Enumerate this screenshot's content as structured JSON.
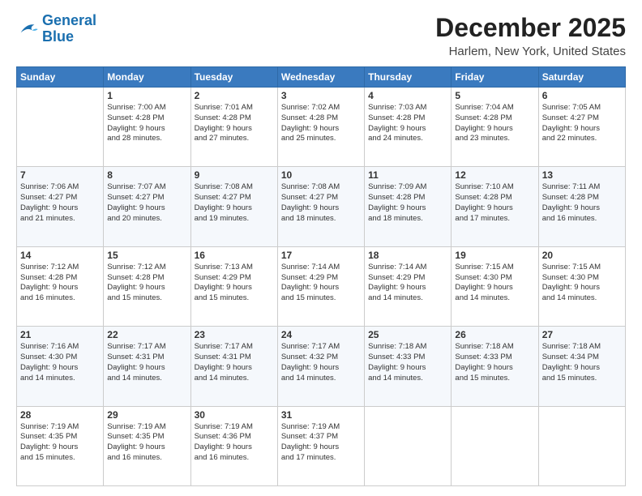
{
  "header": {
    "logo_line1": "General",
    "logo_line2": "Blue",
    "main_title": "December 2025",
    "subtitle": "Harlem, New York, United States"
  },
  "days_of_week": [
    "Sunday",
    "Monday",
    "Tuesday",
    "Wednesday",
    "Thursday",
    "Friday",
    "Saturday"
  ],
  "weeks": [
    [
      {
        "day": "",
        "info": ""
      },
      {
        "day": "1",
        "info": "Sunrise: 7:00 AM\nSunset: 4:28 PM\nDaylight: 9 hours\nand 28 minutes."
      },
      {
        "day": "2",
        "info": "Sunrise: 7:01 AM\nSunset: 4:28 PM\nDaylight: 9 hours\nand 27 minutes."
      },
      {
        "day": "3",
        "info": "Sunrise: 7:02 AM\nSunset: 4:28 PM\nDaylight: 9 hours\nand 25 minutes."
      },
      {
        "day": "4",
        "info": "Sunrise: 7:03 AM\nSunset: 4:28 PM\nDaylight: 9 hours\nand 24 minutes."
      },
      {
        "day": "5",
        "info": "Sunrise: 7:04 AM\nSunset: 4:28 PM\nDaylight: 9 hours\nand 23 minutes."
      },
      {
        "day": "6",
        "info": "Sunrise: 7:05 AM\nSunset: 4:27 PM\nDaylight: 9 hours\nand 22 minutes."
      }
    ],
    [
      {
        "day": "7",
        "info": "Sunrise: 7:06 AM\nSunset: 4:27 PM\nDaylight: 9 hours\nand 21 minutes."
      },
      {
        "day": "8",
        "info": "Sunrise: 7:07 AM\nSunset: 4:27 PM\nDaylight: 9 hours\nand 20 minutes."
      },
      {
        "day": "9",
        "info": "Sunrise: 7:08 AM\nSunset: 4:27 PM\nDaylight: 9 hours\nand 19 minutes."
      },
      {
        "day": "10",
        "info": "Sunrise: 7:08 AM\nSunset: 4:27 PM\nDaylight: 9 hours\nand 18 minutes."
      },
      {
        "day": "11",
        "info": "Sunrise: 7:09 AM\nSunset: 4:28 PM\nDaylight: 9 hours\nand 18 minutes."
      },
      {
        "day": "12",
        "info": "Sunrise: 7:10 AM\nSunset: 4:28 PM\nDaylight: 9 hours\nand 17 minutes."
      },
      {
        "day": "13",
        "info": "Sunrise: 7:11 AM\nSunset: 4:28 PM\nDaylight: 9 hours\nand 16 minutes."
      }
    ],
    [
      {
        "day": "14",
        "info": "Sunrise: 7:12 AM\nSunset: 4:28 PM\nDaylight: 9 hours\nand 16 minutes."
      },
      {
        "day": "15",
        "info": "Sunrise: 7:12 AM\nSunset: 4:28 PM\nDaylight: 9 hours\nand 15 minutes."
      },
      {
        "day": "16",
        "info": "Sunrise: 7:13 AM\nSunset: 4:29 PM\nDaylight: 9 hours\nand 15 minutes."
      },
      {
        "day": "17",
        "info": "Sunrise: 7:14 AM\nSunset: 4:29 PM\nDaylight: 9 hours\nand 15 minutes."
      },
      {
        "day": "18",
        "info": "Sunrise: 7:14 AM\nSunset: 4:29 PM\nDaylight: 9 hours\nand 14 minutes."
      },
      {
        "day": "19",
        "info": "Sunrise: 7:15 AM\nSunset: 4:30 PM\nDaylight: 9 hours\nand 14 minutes."
      },
      {
        "day": "20",
        "info": "Sunrise: 7:15 AM\nSunset: 4:30 PM\nDaylight: 9 hours\nand 14 minutes."
      }
    ],
    [
      {
        "day": "21",
        "info": "Sunrise: 7:16 AM\nSunset: 4:30 PM\nDaylight: 9 hours\nand 14 minutes."
      },
      {
        "day": "22",
        "info": "Sunrise: 7:17 AM\nSunset: 4:31 PM\nDaylight: 9 hours\nand 14 minutes."
      },
      {
        "day": "23",
        "info": "Sunrise: 7:17 AM\nSunset: 4:31 PM\nDaylight: 9 hours\nand 14 minutes."
      },
      {
        "day": "24",
        "info": "Sunrise: 7:17 AM\nSunset: 4:32 PM\nDaylight: 9 hours\nand 14 minutes."
      },
      {
        "day": "25",
        "info": "Sunrise: 7:18 AM\nSunset: 4:33 PM\nDaylight: 9 hours\nand 14 minutes."
      },
      {
        "day": "26",
        "info": "Sunrise: 7:18 AM\nSunset: 4:33 PM\nDaylight: 9 hours\nand 15 minutes."
      },
      {
        "day": "27",
        "info": "Sunrise: 7:18 AM\nSunset: 4:34 PM\nDaylight: 9 hours\nand 15 minutes."
      }
    ],
    [
      {
        "day": "28",
        "info": "Sunrise: 7:19 AM\nSunset: 4:35 PM\nDaylight: 9 hours\nand 15 minutes."
      },
      {
        "day": "29",
        "info": "Sunrise: 7:19 AM\nSunset: 4:35 PM\nDaylight: 9 hours\nand 16 minutes."
      },
      {
        "day": "30",
        "info": "Sunrise: 7:19 AM\nSunset: 4:36 PM\nDaylight: 9 hours\nand 16 minutes."
      },
      {
        "day": "31",
        "info": "Sunrise: 7:19 AM\nSunset: 4:37 PM\nDaylight: 9 hours\nand 17 minutes."
      },
      {
        "day": "",
        "info": ""
      },
      {
        "day": "",
        "info": ""
      },
      {
        "day": "",
        "info": ""
      }
    ]
  ]
}
